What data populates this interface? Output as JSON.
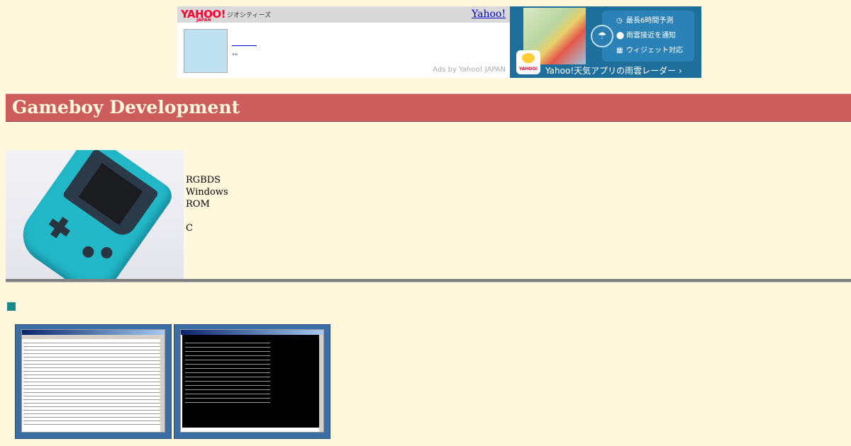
{
  "ad": {
    "logo_text": "YAHOO!",
    "logo_sub": "JAPAN",
    "geocities_label": "ジオシティーズ",
    "yahoo_link": "Yahoo!",
    "quote_mark": "\"\"",
    "ads_by": "Ads by Yahoo! JAPAN",
    "features": [
      {
        "icon": "clock-icon",
        "glyph": "◷",
        "label": "最長6時間予測"
      },
      {
        "icon": "pin-icon",
        "glyph": "⬤",
        "label": "雨雲接近を通知"
      },
      {
        "icon": "widget-icon",
        "glyph": "▦",
        "label": "ウィジェット対応"
      }
    ],
    "app_badge": "YAHOO!",
    "app_caption": "Yahoo!天気アプリの雨雲レーダー ›"
  },
  "page": {
    "title": "Gameboy Development",
    "description_lines": [
      " RGBDS",
      "Windows",
      "ROM",
      "",
      "C"
    ]
  },
  "colors": {
    "background": "#fff8dc",
    "title_bar": "#cd5c5c",
    "bullet": "#1a8a88"
  }
}
